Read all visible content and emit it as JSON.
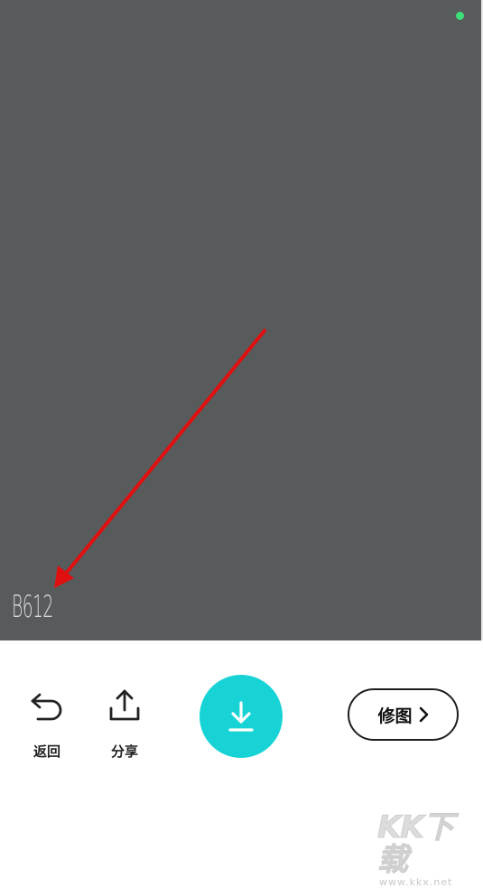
{
  "preview": {
    "watermark": "B612",
    "colors": {
      "background": "#585b5b",
      "annotation_arrow": "#e01010",
      "status_dot": "#3ee07a"
    }
  },
  "toolbar": {
    "back": {
      "label": "返回",
      "icon": "undo-arrow-icon"
    },
    "share": {
      "label": "分享",
      "icon": "share-upload-icon"
    },
    "save": {
      "icon": "download-icon",
      "color": "#17d3d6"
    },
    "edit": {
      "label": "修图",
      "icon": "chevron-right-icon"
    }
  },
  "site_watermark": {
    "logo_text": "KK下载",
    "url": "www.kkx.net"
  }
}
